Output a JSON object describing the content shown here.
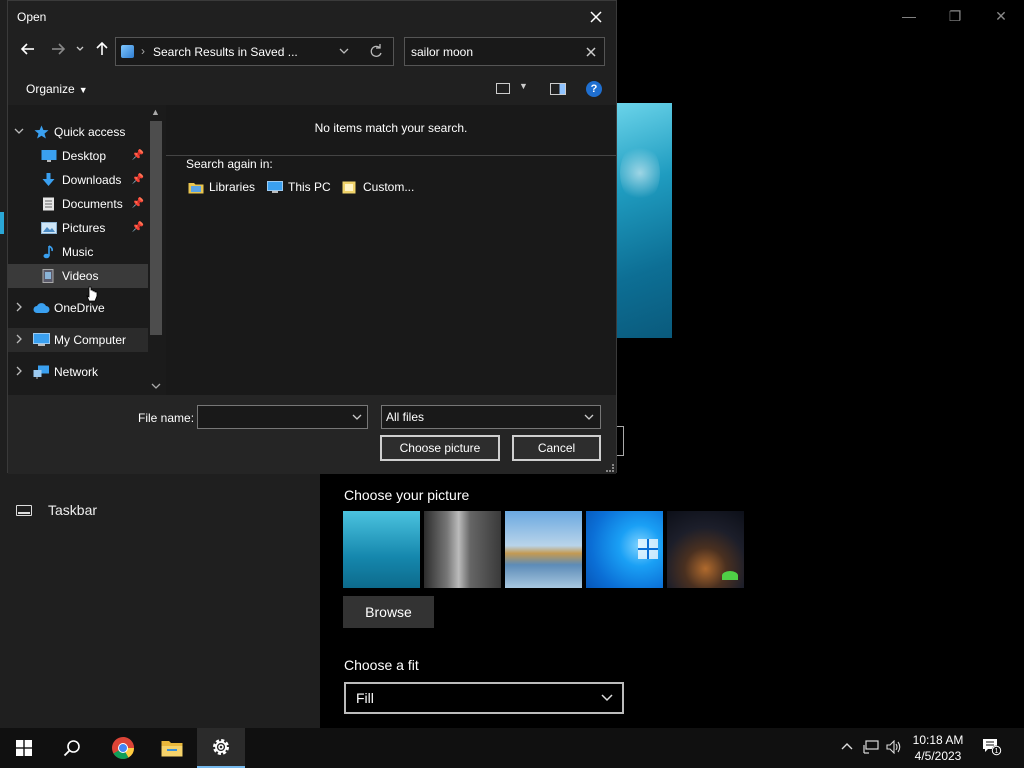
{
  "settings": {
    "nav_taskbar": "Taskbar",
    "choose_picture_label": "Choose your picture",
    "browse_label": "Browse",
    "choose_fit_label": "Choose a fit",
    "fit_value": "Fill",
    "window_controls": {
      "minimize": "—",
      "maximize": "❐",
      "close": "✕"
    }
  },
  "dialog": {
    "title": "Open",
    "address": "Search Results in Saved ...",
    "search_value": "sailor moon",
    "organize_label": "Organize",
    "nav_items": [
      {
        "label": "Quick access",
        "icon": "star-icon"
      },
      {
        "label": "Desktop",
        "icon": "desktop-icon",
        "pinned": true
      },
      {
        "label": "Downloads",
        "icon": "download-icon",
        "pinned": true
      },
      {
        "label": "Documents",
        "icon": "document-icon",
        "pinned": true
      },
      {
        "label": "Pictures",
        "icon": "pictures-icon",
        "pinned": true
      },
      {
        "label": "Music",
        "icon": "music-icon"
      },
      {
        "label": "Videos",
        "icon": "video-icon"
      },
      {
        "label": "OneDrive",
        "icon": "cloud-icon"
      },
      {
        "label": "My Computer",
        "icon": "computer-icon"
      },
      {
        "label": "Network",
        "icon": "network-icon"
      }
    ],
    "no_items_message": "No items match your search.",
    "search_again_label": "Search again in:",
    "search_locations": [
      "Libraries",
      "This PC",
      "Custom..."
    ],
    "file_name_label": "File name:",
    "file_name_value": "",
    "file_type_value": "All files",
    "choose_button": "Choose picture",
    "cancel_button": "Cancel"
  },
  "taskbar": {
    "time": "10:18 AM",
    "date": "4/5/2023",
    "notification_count": "1"
  },
  "colors": {
    "accent": "#76b9ed",
    "dialog_bg": "#202020",
    "help_blue": "#1f6fd0"
  }
}
